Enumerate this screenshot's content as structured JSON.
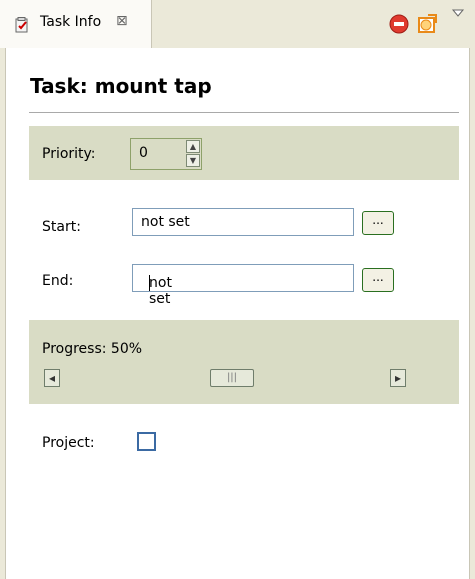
{
  "view": {
    "tab_title": "Task Info",
    "tab_close": "⊠",
    "tab_icon": "task-info-icon",
    "toolbar_icons": [
      "stop-icon",
      "task-check-icon",
      "view-menu-icon"
    ]
  },
  "task": {
    "title": "Task: mount tap"
  },
  "priority": {
    "label": "Priority:",
    "value": "0"
  },
  "start": {
    "label": "Start:",
    "value": "not set",
    "button": "..."
  },
  "end": {
    "label": "End:",
    "value": "not set",
    "button": "..."
  },
  "progress": {
    "label": "Progress: 50%",
    "value_percent": 50
  },
  "project": {
    "label": "Project:",
    "checked": false
  },
  "colors": {
    "band": "#d9dcc5",
    "tabbar": "#ebe9d9"
  }
}
